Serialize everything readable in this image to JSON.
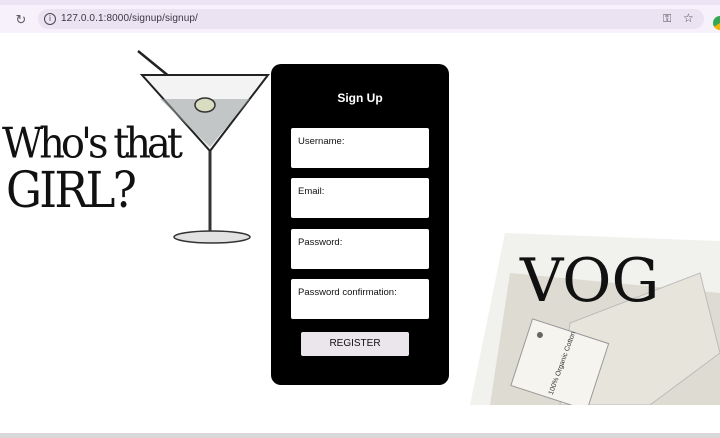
{
  "browser": {
    "url": "127.0.0.1:8000/signup/signup/",
    "reload_icon": "reload-icon",
    "info_icon": "info-icon",
    "key_icon": "key-icon",
    "star_icon": "star-icon",
    "extension_icon": "extension-icon"
  },
  "background": {
    "headline_line1": "Who's that",
    "headline_line2": "GIRL?",
    "collage_word": "VOG",
    "tag_text": "100% Organic Cotton"
  },
  "form": {
    "title": "Sign Up",
    "fields": [
      {
        "label": "Username:"
      },
      {
        "label": "Email:"
      },
      {
        "label": "Password:"
      },
      {
        "label": "Password confirmation:"
      }
    ],
    "submit_label": "REGISTER"
  },
  "colors": {
    "card": "#000000",
    "button": "#eae6ec",
    "chrome": "#f7f1fb"
  }
}
